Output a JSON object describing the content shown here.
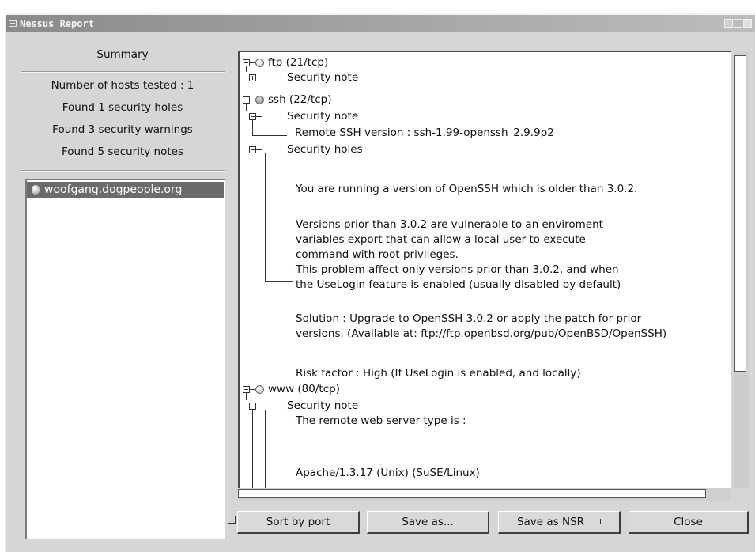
{
  "window": {
    "title": "Nessus Report"
  },
  "summary": {
    "title": "Summary",
    "lines": [
      "Number of hosts tested : 1",
      "Found 1 security holes",
      "Found 3 security warnings",
      "Found 5 security notes"
    ]
  },
  "hosts": [
    {
      "name": "woofgang.dogpeople.org"
    }
  ],
  "report": {
    "ftp": "ftp (21/tcp)",
    "ftp_note": "Security note",
    "ssh": "ssh (22/tcp)",
    "ssh_note": "Security note",
    "ssh_note_text": "Remote SSH version : ssh-1.99-openssh_2.9.9p2",
    "ssh_holes": "Security holes",
    "hole_lines": [
      "You are running a version of OpenSSH which is older than 3.0.2.",
      "",
      "Versions prior than 3.0.2 are vulnerable to an enviroment",
      "variables export that can allow a local user to execute",
      "command with root privileges.",
      "This problem affect only versions prior than 3.0.2, and when",
      "the UseLogin feature is enabled (usually disabled by default)",
      "",
      "Solution : Upgrade to OpenSSH 3.0.2 or apply the patch for prior",
      "versions. (Available at: ftp://ftp.openbsd.org/pub/OpenBSD/OpenSSH)",
      "",
      "Risk factor : High (If UseLogin is enabled, and locally)"
    ],
    "www": "www (80/tcp)",
    "www_note": "Security note",
    "www_lines": [
      "The remote web server type is :",
      "",
      "Apache/1.3.17 (Unix)  (SuSE/Linux)"
    ]
  },
  "buttons": {
    "sort": "Sort by port",
    "save_as": "Save as...",
    "save_nsr": "Save as NSR",
    "close": "Close"
  }
}
